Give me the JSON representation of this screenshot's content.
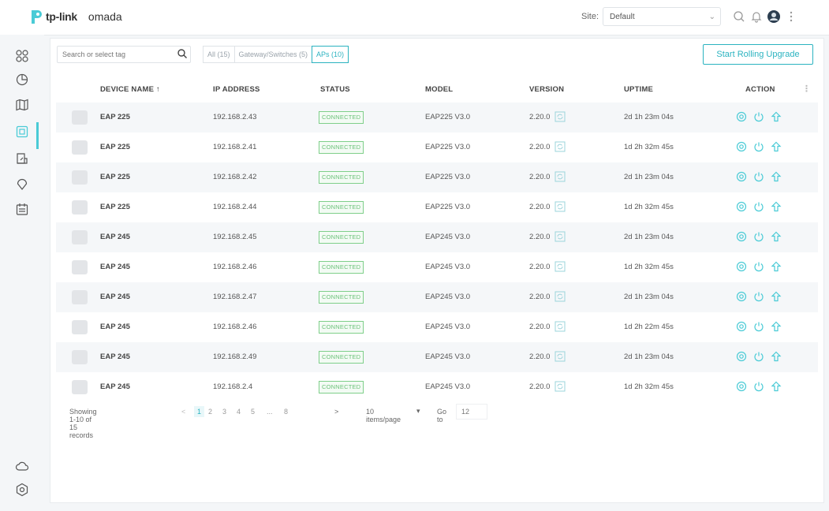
{
  "header": {
    "brand": "tp-link",
    "product": "omada",
    "site_label": "Site:",
    "site_value": "Default"
  },
  "toolbar": {
    "search_placeholder": "Search or select tag",
    "filters": [
      {
        "label": "All (15)",
        "active": false
      },
      {
        "label": "Gateway/Switches (5)",
        "active": false
      },
      {
        "label": "APs (10)",
        "active": true
      }
    ],
    "upgrade_label": "Start Rolling Upgrade"
  },
  "table": {
    "columns": [
      "DEVICE NAME ↑",
      "IP ADDRESS",
      "STATUS",
      "MODEL",
      "VERSION",
      "UPTIME",
      "ACTION"
    ],
    "rows": [
      {
        "name": "EAP 225",
        "ip": "192.168.2.43",
        "status": "CONNECTED",
        "model": "EAP225 V3.0",
        "version": "2.20.0",
        "uptime": "2d 1h 23m 04s"
      },
      {
        "name": "EAP 225",
        "ip": "192.168.2.41",
        "status": "CONNECTED",
        "model": "EAP225 V3.0",
        "version": "2.20.0",
        "uptime": "1d 2h 32m 45s"
      },
      {
        "name": "EAP 225",
        "ip": "192.168.2.42",
        "status": "CONNECTED",
        "model": "EAP225 V3.0",
        "version": "2.20.0",
        "uptime": "2d 1h 23m 04s"
      },
      {
        "name": "EAP 225",
        "ip": "192.168.2.44",
        "status": "CONNECTED",
        "model": "EAP225 V3.0",
        "version": "2.20.0",
        "uptime": "1d 2h 32m 45s"
      },
      {
        "name": "EAP 245",
        "ip": "192.168.2.45",
        "status": "CONNECTED",
        "model": "EAP245 V3.0",
        "version": "2.20.0",
        "uptime": "2d 1h 23m 04s"
      },
      {
        "name": "EAP 245",
        "ip": "192.168.2.46",
        "status": "CONNECTED",
        "model": "EAP245 V3.0",
        "version": "2.20.0",
        "uptime": "1d 2h 32m 45s"
      },
      {
        "name": "EAP 245",
        "ip": "192.168.2.47",
        "status": "CONNECTED",
        "model": "EAP245 V3.0",
        "version": "2.20.0",
        "uptime": "2d 1h 23m 04s"
      },
      {
        "name": "EAP 245",
        "ip": "192.168.2.46",
        "status": "CONNECTED",
        "model": "EAP245 V3.0",
        "version": "2.20.0",
        "uptime": "1d 2h 22m 45s"
      },
      {
        "name": "EAP 245",
        "ip": "192.168.2.49",
        "status": "CONNECTED",
        "model": "EAP245 V3.0",
        "version": "2.20.0",
        "uptime": "2d 1h 23m 04s"
      },
      {
        "name": "EAP 245",
        "ip": "192.168.2.4",
        "status": "CONNECTED",
        "model": "EAP245 V3.0",
        "version": "2.20.0",
        "uptime": "1d 2h 32m 45s"
      }
    ]
  },
  "pagination": {
    "summary": "Showing 1-10 of 15 records",
    "prev": "<",
    "pages": [
      "1",
      "2",
      "3",
      "4",
      "5",
      "...",
      "8"
    ],
    "current": "1",
    "next": ">",
    "per_page": "10 items/page",
    "goto_label": "Go to",
    "goto_value": "12"
  },
  "icons": {
    "rail": [
      "dashboard-icon",
      "statistics-icon",
      "map-icon",
      "devices-icon",
      "logs-icon",
      "insight-icon",
      "reports-icon",
      "cloud-icon",
      "settings-icon"
    ],
    "header": [
      "search-icon",
      "bell-icon",
      "user-avatar",
      "more-vertical-icon"
    ],
    "actions": [
      "locate-icon",
      "reboot-icon",
      "upgrade-icon"
    ]
  },
  "colors": {
    "accent": "#2bb3c0",
    "status_green": "#6cc27a",
    "rail_active": "#4acbd6"
  }
}
